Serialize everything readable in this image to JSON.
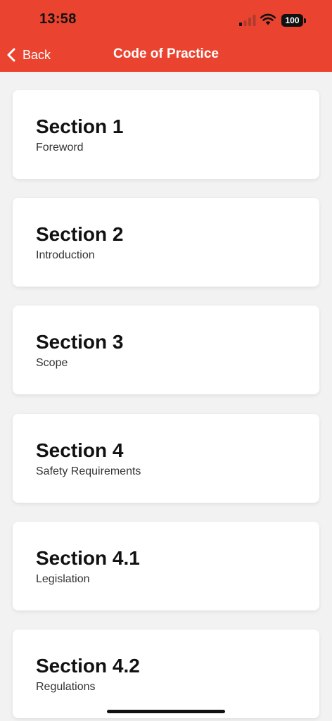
{
  "status_bar": {
    "time": "13:58",
    "battery": "100"
  },
  "nav": {
    "back_label": "Back",
    "title": "Code of Practice"
  },
  "sections": [
    {
      "title": "Section 1",
      "subtitle": "Foreword"
    },
    {
      "title": "Section 2",
      "subtitle": "Introduction"
    },
    {
      "title": "Section 3",
      "subtitle": "Scope"
    },
    {
      "title": "Section 4",
      "subtitle": "Safety Requirements"
    },
    {
      "title": "Section 4.1",
      "subtitle": "Legislation"
    },
    {
      "title": "Section 4.2",
      "subtitle": "Regulations"
    }
  ],
  "colors": {
    "header": "#ea4430",
    "background": "#f2f2f2",
    "card": "#ffffff",
    "signal_inactive": "#b03a2e"
  },
  "icons": {
    "back": "chevron-left-icon",
    "signal": "cellular-signal-icon",
    "wifi": "wifi-icon",
    "battery": "battery-icon"
  }
}
